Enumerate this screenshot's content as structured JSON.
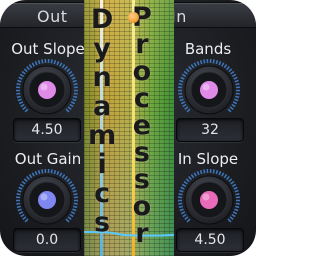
{
  "header": {
    "left_label": "Out",
    "right_label": "In"
  },
  "controls": [
    {
      "id": "out-slope",
      "label": "Out Slope",
      "value": "4.50",
      "knob_color": "#e08ae8"
    },
    {
      "id": "out-gain",
      "label": "Out Gain",
      "value": "0.0",
      "knob_color": "#7f86f0"
    },
    {
      "id": "bands",
      "label": "Bands",
      "value": "32",
      "knob_color": "#e08ae8"
    },
    {
      "id": "in-slope",
      "label": "In Slope",
      "value": "4.50",
      "knob_color": "#e86ab8"
    }
  ],
  "title": {
    "word1": "Dynamics",
    "word2": "Processor"
  },
  "indicator": {
    "color": "#f2a23a",
    "text_color": "#1a1a1a"
  },
  "colors": {
    "accent_blue": "#4ab8ff",
    "accent_yellow": "#ffe46a"
  }
}
